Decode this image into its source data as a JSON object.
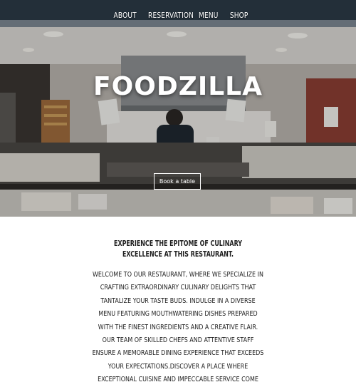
{
  "nav": {
    "items": [
      {
        "label": "ABOUT"
      },
      {
        "label": "RESERVATION"
      },
      {
        "label": "MENU"
      },
      {
        "label": "SHOP"
      }
    ]
  },
  "hero": {
    "title": "FOODZILLA",
    "cta_label": "Book a table"
  },
  "about": {
    "heading": "EXPERIENCE THE EPITOME OF CULINARY EXCELLENCE AT THIS RESTAURANT.",
    "body": "WELCOME TO OUR RESTAURANT, WHERE WE SPECIALIZE IN CRAFTING EXTRAORDINARY CULINARY DELIGHTS THAT TANTALIZE YOUR TASTE BUDS. INDULGE IN A DIVERSE MENU FEATURING MOUTHWATERING DISHES PREPARED WITH THE FINEST INGREDIENTS AND A CREATIVE FLAIR. OUR TEAM OF SKILLED CHEFS AND ATTENTIVE STAFF ENSURE A MEMORABLE DINING EXPERIENCE THAT EXCEEDS YOUR EXPECTATIONS.DISCOVER A PLACE WHERE EXCEPTIONAL CUISINE AND IMPECCABLE SERVICE COME"
  },
  "colors": {
    "hero_overlay": "#6f6e6c",
    "text_dark": "#1e1e1e",
    "white": "#ffffff"
  }
}
